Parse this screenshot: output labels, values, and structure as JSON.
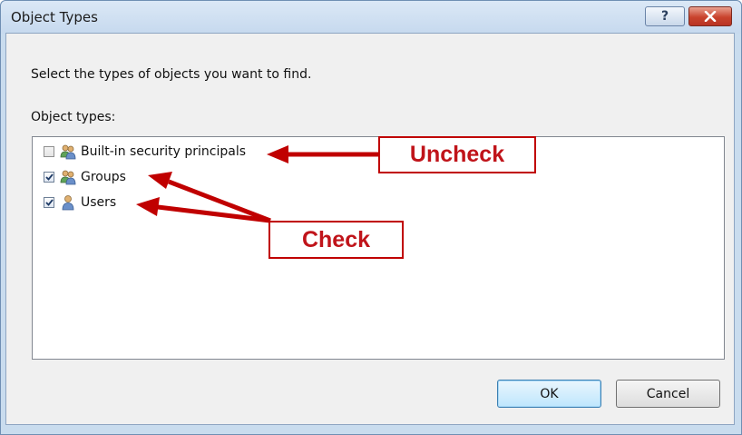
{
  "dialog": {
    "title": "Object Types",
    "help_button": "?",
    "prompt": "Select the types of objects you want to find.",
    "list_label": "Object types:",
    "object_types": [
      {
        "label": "Built-in security principals",
        "checked": false,
        "icon": "group-users-icon"
      },
      {
        "label": "Groups",
        "checked": true,
        "icon": "group-users-icon"
      },
      {
        "label": "Users",
        "checked": true,
        "icon": "user-icon"
      }
    ],
    "ok_label": "OK",
    "cancel_label": "Cancel"
  },
  "annotations": {
    "uncheck": "Uncheck",
    "check": "Check",
    "color": "#c00000"
  }
}
